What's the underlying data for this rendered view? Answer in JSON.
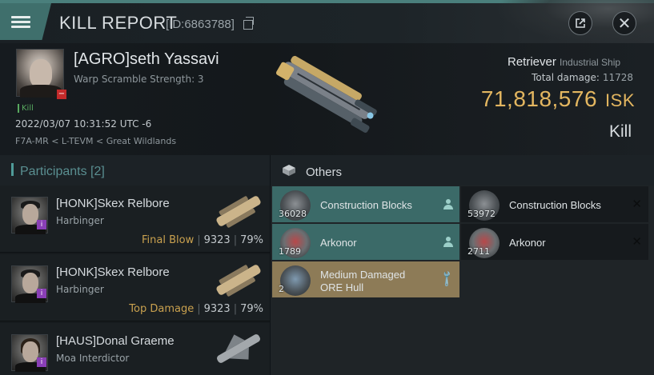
{
  "header": {
    "title": "KILL REPORT",
    "id_label": "[ID:6863788]"
  },
  "victim": {
    "name": "[AGRO]seth Yassavi",
    "warp_scramble": "Warp Scramble Strength: 3",
    "kill_tag": "Kill",
    "datetime": "2022/03/07 10:31:52 UTC -6",
    "location": "F7A-MR < L-TEVM < Great Wildlands",
    "ship_name": "Retriever",
    "ship_class": "Industrial Ship",
    "total_damage_label": "Total damage:",
    "total_damage": "11728",
    "isk_value": "71,818,576",
    "isk_unit": "ISK",
    "result_label": "Kill"
  },
  "participants": {
    "header": "Participants [2]",
    "rows": [
      {
        "name": "[HONK]Skex Relbore",
        "ship": "Harbinger",
        "tag": "Final Blow",
        "damage": "9323",
        "percent": "79%"
      },
      {
        "name": "[HONK]Skex Relbore",
        "ship": "Harbinger",
        "tag": "Top Damage",
        "damage": "9323",
        "percent": "79%"
      },
      {
        "name": "[HAUS]Donal Graeme",
        "ship": "Moa Interdictor",
        "tag": "",
        "damage": "",
        "percent": ""
      }
    ]
  },
  "others": {
    "header": "Others",
    "items": [
      {
        "name": "Construction Blocks",
        "qty": "36028",
        "state": "dropped"
      },
      {
        "name": "Construction Blocks",
        "qty": "53972",
        "state": "destroyed"
      },
      {
        "name": "Arkonor",
        "qty": "1789",
        "state": "dropped"
      },
      {
        "name": "Arkonor",
        "qty": "2711",
        "state": "destroyed"
      },
      {
        "name_line1": "Medium Damaged",
        "name_line2": "ORE Hull",
        "qty": "2",
        "state": "fitted"
      }
    ]
  },
  "colors": {
    "accent_teal": "#3b6a68",
    "isk_gold": "#e3b660",
    "tag_gold": "#c9a14f"
  }
}
